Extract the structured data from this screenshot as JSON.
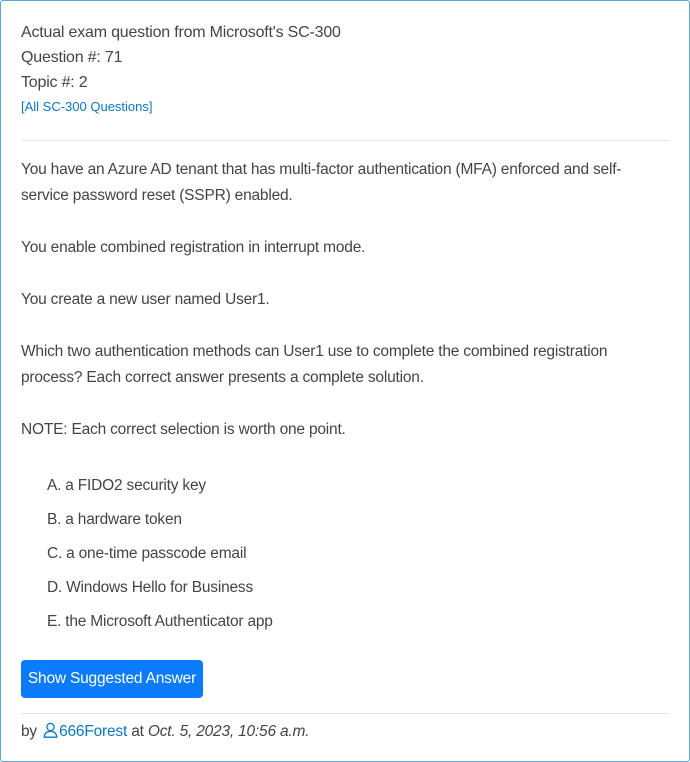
{
  "header": {
    "title": "Actual exam question from Microsoft's SC-300",
    "question_number": "Question #: 71",
    "topic": "Topic #: 2",
    "all_questions_link": "[All SC-300 Questions]"
  },
  "question": {
    "paragraphs": [
      "You have an Azure AD tenant that has multi-factor authentication (MFA) enforced and self-service password reset (SSPR) enabled.",
      "You enable combined registration in interrupt mode.",
      "You create a new user named User1.",
      "Which two authentication methods can User1 use to complete the combined registration process? Each correct answer presents a complete solution.",
      "NOTE: Each correct selection is worth one point."
    ]
  },
  "choices": [
    {
      "letter": "A.",
      "text": "a FIDO2 security key"
    },
    {
      "letter": "B.",
      "text": "a hardware token"
    },
    {
      "letter": "C.",
      "text": "a one-time passcode email"
    },
    {
      "letter": "D.",
      "text": "Windows Hello for Business"
    },
    {
      "letter": "E.",
      "text": "the Microsoft Authenticator app"
    }
  ],
  "show_answer_button": "Show Suggested Answer",
  "footer": {
    "by": "by",
    "user_icon": "user-icon",
    "username": "666Forest",
    "at": "at",
    "date": "Oct. 5, 2023, 10:56 a.m."
  },
  "colors": {
    "accent": "#0a7bfa",
    "link": "#0b78c2",
    "border": "#5aa6d6"
  }
}
